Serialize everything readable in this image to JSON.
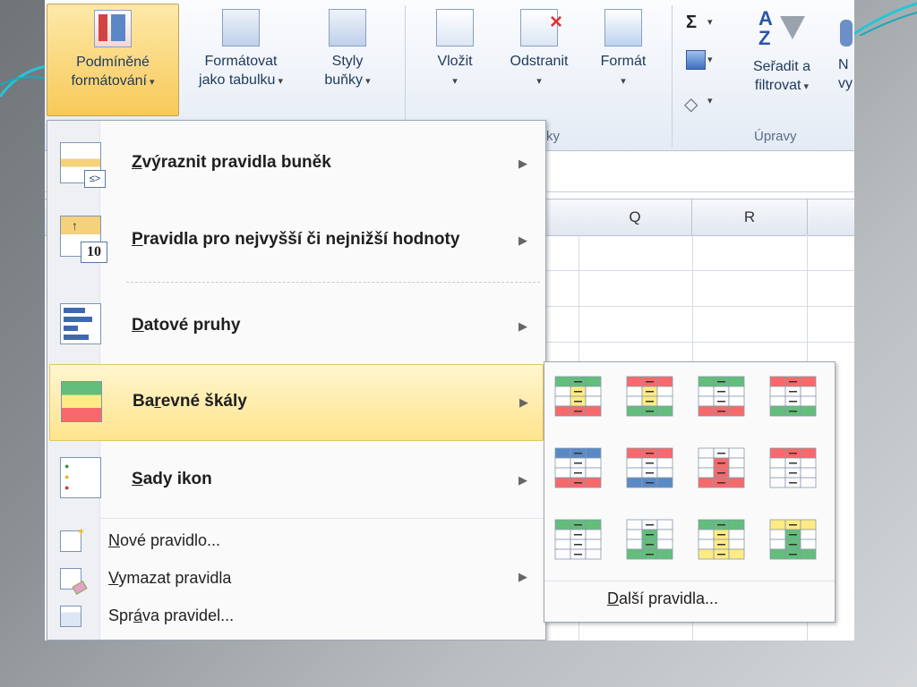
{
  "ribbon": {
    "buttons": [
      {
        "line1": "Podmíněné",
        "line2": "formátování"
      },
      {
        "line1": "Formátovat",
        "line2": "jako tabulku"
      },
      {
        "line1": "Styly",
        "line2": "buňky"
      },
      {
        "line1": "Vložit"
      },
      {
        "line1": "Odstranit"
      },
      {
        "line1": "Formát"
      },
      {
        "line1": "Seřadit a",
        "line2": "filtrovat"
      },
      {
        "line1": "N",
        "line2": "vy"
      }
    ],
    "groups": {
      "cells_partial": "ky",
      "editing": "Úpravy"
    },
    "sigma": "Σ"
  },
  "sheet": {
    "columns": [
      "Q",
      "R"
    ]
  },
  "menu": {
    "items": [
      {
        "pre": "",
        "ul": "Z",
        "post": "výraznit pravidla buněk"
      },
      {
        "pre": "",
        "ul": "P",
        "post": "ravidla pro nejvyšší či nejnižší hodnoty"
      },
      {
        "pre": "",
        "ul": "D",
        "post": "atové pruhy"
      },
      {
        "pre": "Ba",
        "ul": "r",
        "post": "evné škály"
      },
      {
        "pre": "",
        "ul": "S",
        "post": "ady ikon"
      }
    ],
    "small_items": [
      {
        "pre": "",
        "ul": "N",
        "post": "ové pravidlo..."
      },
      {
        "pre": "",
        "ul": "V",
        "post": "ymazat pravidla"
      },
      {
        "pre": "Spr",
        "ul": "á",
        "post": "va pravidel..."
      }
    ]
  },
  "submenu": {
    "more": {
      "pre": "",
      "ul": "D",
      "post": "alší pravidla..."
    },
    "swatch_colors": [
      [
        "#63be7b",
        "#ffeb84",
        "#f8696b"
      ],
      [
        "#f8696b",
        "#ffeb84",
        "#63be7b"
      ],
      [
        "#63be7b",
        "#fcfcff",
        "#f8696b"
      ],
      [
        "#f8696b",
        "#fcfcff",
        "#63be7b"
      ],
      [
        "#5a8ac6",
        "#fcfcff",
        "#f8696b"
      ],
      [
        "#f8696b",
        "#fcfcff",
        "#5a8ac6"
      ],
      [
        "#fcfcff",
        "#f8696b",
        "#f8696b"
      ],
      [
        "#f8696b",
        "#fcfcff",
        "#fcfcff"
      ],
      [
        "#63be7b",
        "#fcfcff",
        "#fcfcff"
      ],
      [
        "#fcfcff",
        "#63be7b",
        "#63be7b"
      ],
      [
        "#63be7b",
        "#ffeb84",
        "#ffeb84"
      ],
      [
        "#ffeb84",
        "#63be7b",
        "#63be7b"
      ]
    ]
  },
  "colors": {
    "accent_teal": "#22c6d8",
    "highlight": "#ffe48d"
  }
}
